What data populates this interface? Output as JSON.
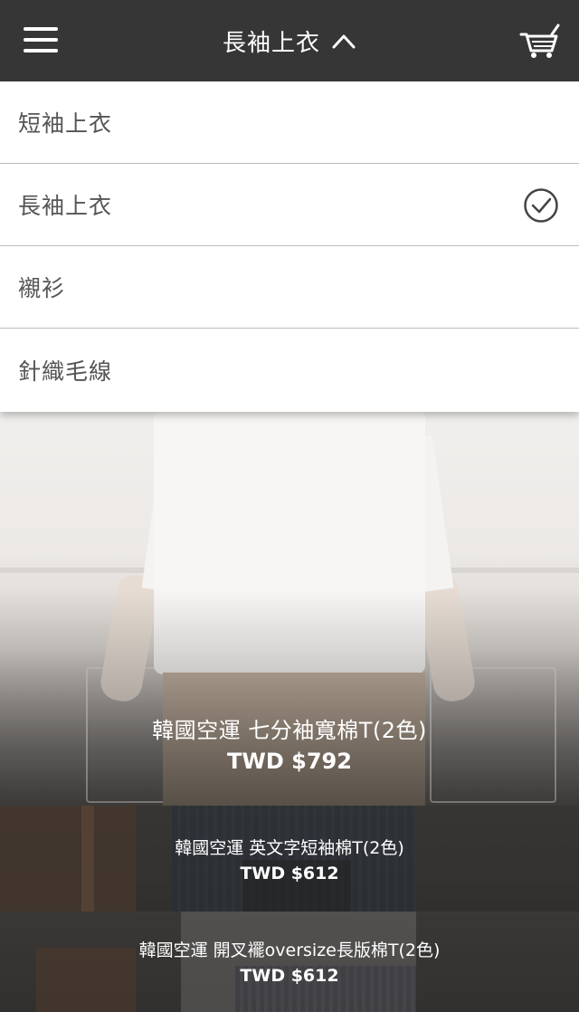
{
  "header": {
    "title": "長袖上衣",
    "menu_icon": "hamburger-menu-icon",
    "cart_icon": "shopping-cart-icon",
    "background_color": "#363636"
  },
  "dropdown": {
    "items": [
      {
        "label": "短袖上衣",
        "selected": false
      },
      {
        "label": "長袖上衣",
        "selected": true
      },
      {
        "label": "襯衫",
        "selected": false
      },
      {
        "label": "針織毛線",
        "selected": false
      }
    ],
    "selected_icon": "check-circle-icon"
  },
  "products": [
    {
      "name": "韓國空運 七分袖寬棉T(2色)",
      "price": "TWD $792"
    },
    {
      "name": "韓國空運 英文字短袖棉T(2色)",
      "price": "TWD $612"
    },
    {
      "name": "韓國空運 開叉襬oversize長版棉T(2色)",
      "price": "TWD $612"
    }
  ]
}
